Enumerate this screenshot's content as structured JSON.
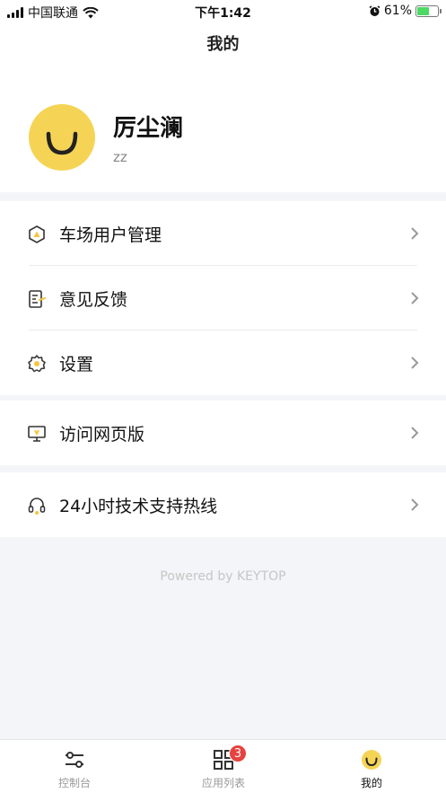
{
  "status_bar": {
    "carrier": "中国联通",
    "time": "下午1:42",
    "battery_percent": "61%",
    "battery_level": 0.61,
    "icons": [
      "signal-icon",
      "wifi-icon",
      "alarm-icon",
      "battery-charging-icon"
    ]
  },
  "header": {
    "title": "我的"
  },
  "profile": {
    "name": "厉尘澜",
    "account": "zz",
    "avatar_color": "#f5d455"
  },
  "menu_groups": [
    {
      "items": [
        {
          "label": "车场用户管理",
          "icon": "parking-user-icon"
        },
        {
          "label": "意见反馈",
          "icon": "feedback-icon"
        },
        {
          "label": "设置",
          "icon": "settings-gear-icon"
        }
      ]
    },
    {
      "items": [
        {
          "label": "访问网页版",
          "icon": "monitor-icon"
        }
      ]
    },
    {
      "items": [
        {
          "label": "24小时技术支持热线",
          "icon": "headset-icon"
        }
      ]
    }
  ],
  "footer": {
    "powered_by": "Powered by KEYTOP"
  },
  "tabbar": {
    "tabs": [
      {
        "label": "控制台",
        "icon": "sliders-icon"
      },
      {
        "label": "应用列表",
        "icon": "apps-grid-icon",
        "badge": "3"
      },
      {
        "label": "我的",
        "icon": "smiley-icon",
        "active": true
      }
    ]
  },
  "colors": {
    "accent": "#f5c542",
    "badge": "#e64340"
  }
}
